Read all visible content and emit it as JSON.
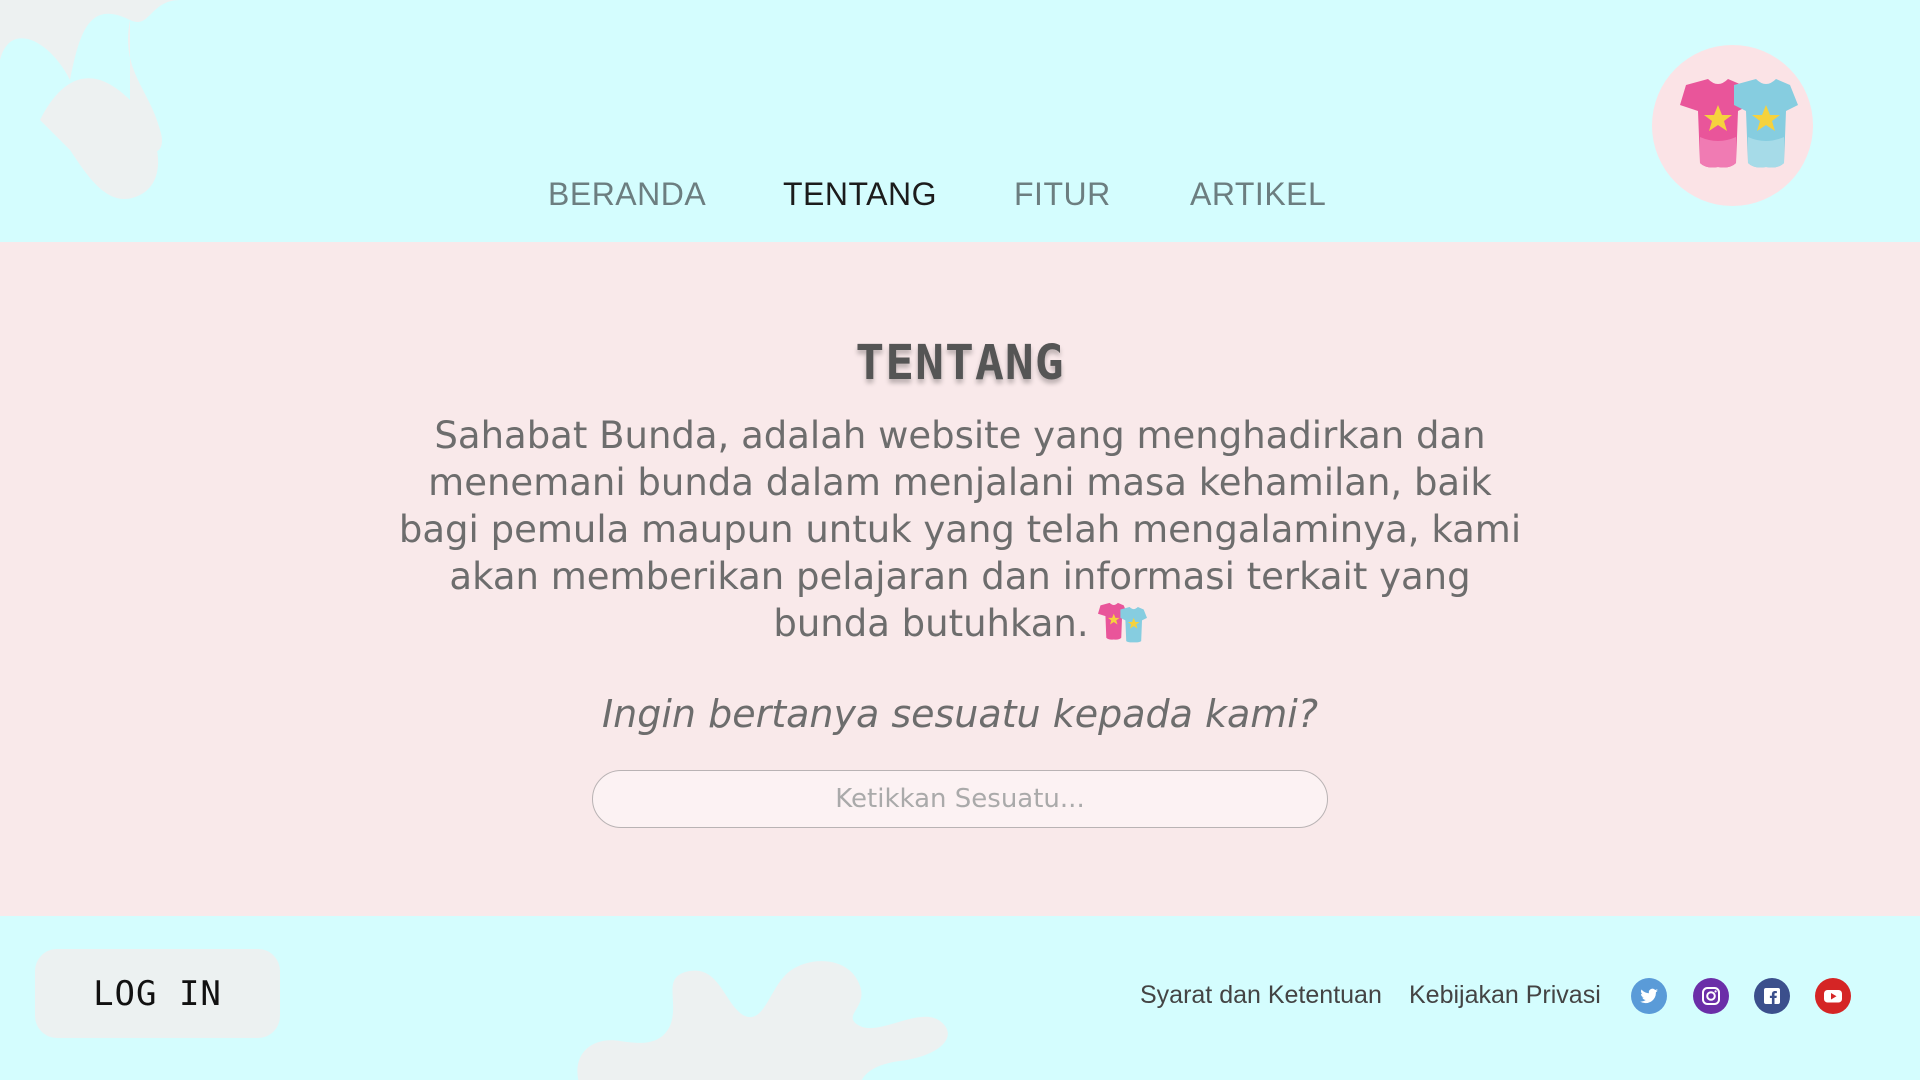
{
  "nav": {
    "items": [
      {
        "label": "BERANDA"
      },
      {
        "label": "TENTANG"
      },
      {
        "label": "FITUR"
      },
      {
        "label": "ARTIKEL"
      }
    ],
    "active": "TENTANG"
  },
  "logo": {
    "icon": "baby-onesies-icon"
  },
  "about": {
    "title": "TENTANG",
    "description": "Sahabat Bunda, adalah website yang menghadirkan dan menemani bunda dalam menjalani masa kehamilan, baik bagi pemula maupun untuk yang telah mengalaminya, kami akan memberikan pelajaran dan informasi terkait yang bunda butuhkan.",
    "question": "Ingin bertanya sesuatu kepada kami?",
    "search_placeholder": "Ketikkan Sesuatu..."
  },
  "footer": {
    "login_label": "LOG IN",
    "terms_label": "Syarat dan Ketentuan",
    "privacy_label": "Kebijakan Privasi",
    "social": [
      {
        "icon": "twitter-icon"
      },
      {
        "icon": "instagram-icon"
      },
      {
        "icon": "facebook-icon"
      },
      {
        "icon": "youtube-icon"
      }
    ]
  },
  "colors": {
    "background": "#d4fdfe",
    "main_section": "#f9e9ea",
    "active_nav": "#1c1c1c",
    "inactive_nav": "#6c7e80"
  }
}
